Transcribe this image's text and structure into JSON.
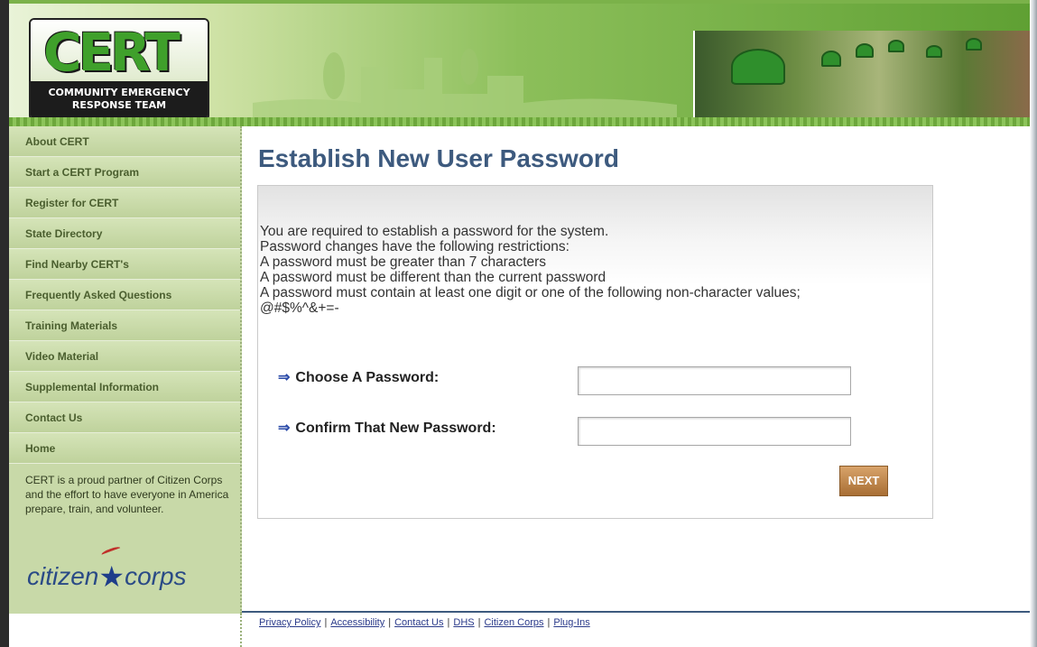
{
  "header": {
    "logo": {
      "text": "CERT",
      "subtitle_line1": "COMMUNITY EMERGENCY",
      "subtitle_line2": "RESPONSE TEAM"
    },
    "colors": {
      "green": "#5fa033",
      "pale_green": "#cfe2a6"
    }
  },
  "sidebar": {
    "items": [
      {
        "label": "About CERT"
      },
      {
        "label": "Start a CERT Program"
      },
      {
        "label": "Register for CERT"
      },
      {
        "label": "State Directory"
      },
      {
        "label": "Find Nearby CERT's"
      },
      {
        "label": "Frequently Asked Questions"
      },
      {
        "label": "Training Materials"
      },
      {
        "label": "Video Material"
      },
      {
        "label": "Supplemental Information"
      },
      {
        "label": "Contact Us"
      },
      {
        "label": "Home"
      }
    ],
    "partner_text": "CERT is a proud partner of Citizen Corps and the effort to have everyone in America prepare, train, and volunteer.",
    "partner_logo": {
      "word1": "citizen",
      "word2": "corps",
      "icon": "star-icon"
    }
  },
  "main": {
    "title": "Establish New User Password",
    "message_lines": [
      "You are required to establish a password for the system.",
      "Password changes have the following restrictions:",
      "A password must be greater than 7 characters",
      "A password must be different than the current password",
      "A password must contain at least one digit or one of the following non-character values;",
      "@#$%^&+=-"
    ],
    "fields": {
      "choose_label": "Choose A Password:",
      "choose_value": "",
      "confirm_label": "Confirm That New Password:",
      "confirm_value": ""
    },
    "next_button": "NEXT",
    "colors": {
      "title": "#3d5a7e",
      "button": "#b57a3e"
    }
  },
  "footer": {
    "links": [
      {
        "label": "Privacy Policy"
      },
      {
        "label": "Accessibility"
      },
      {
        "label": "Contact Us"
      },
      {
        "label": "DHS"
      },
      {
        "label": "Citizen Corps"
      },
      {
        "label": "Plug-Ins"
      }
    ],
    "separator": "|"
  }
}
